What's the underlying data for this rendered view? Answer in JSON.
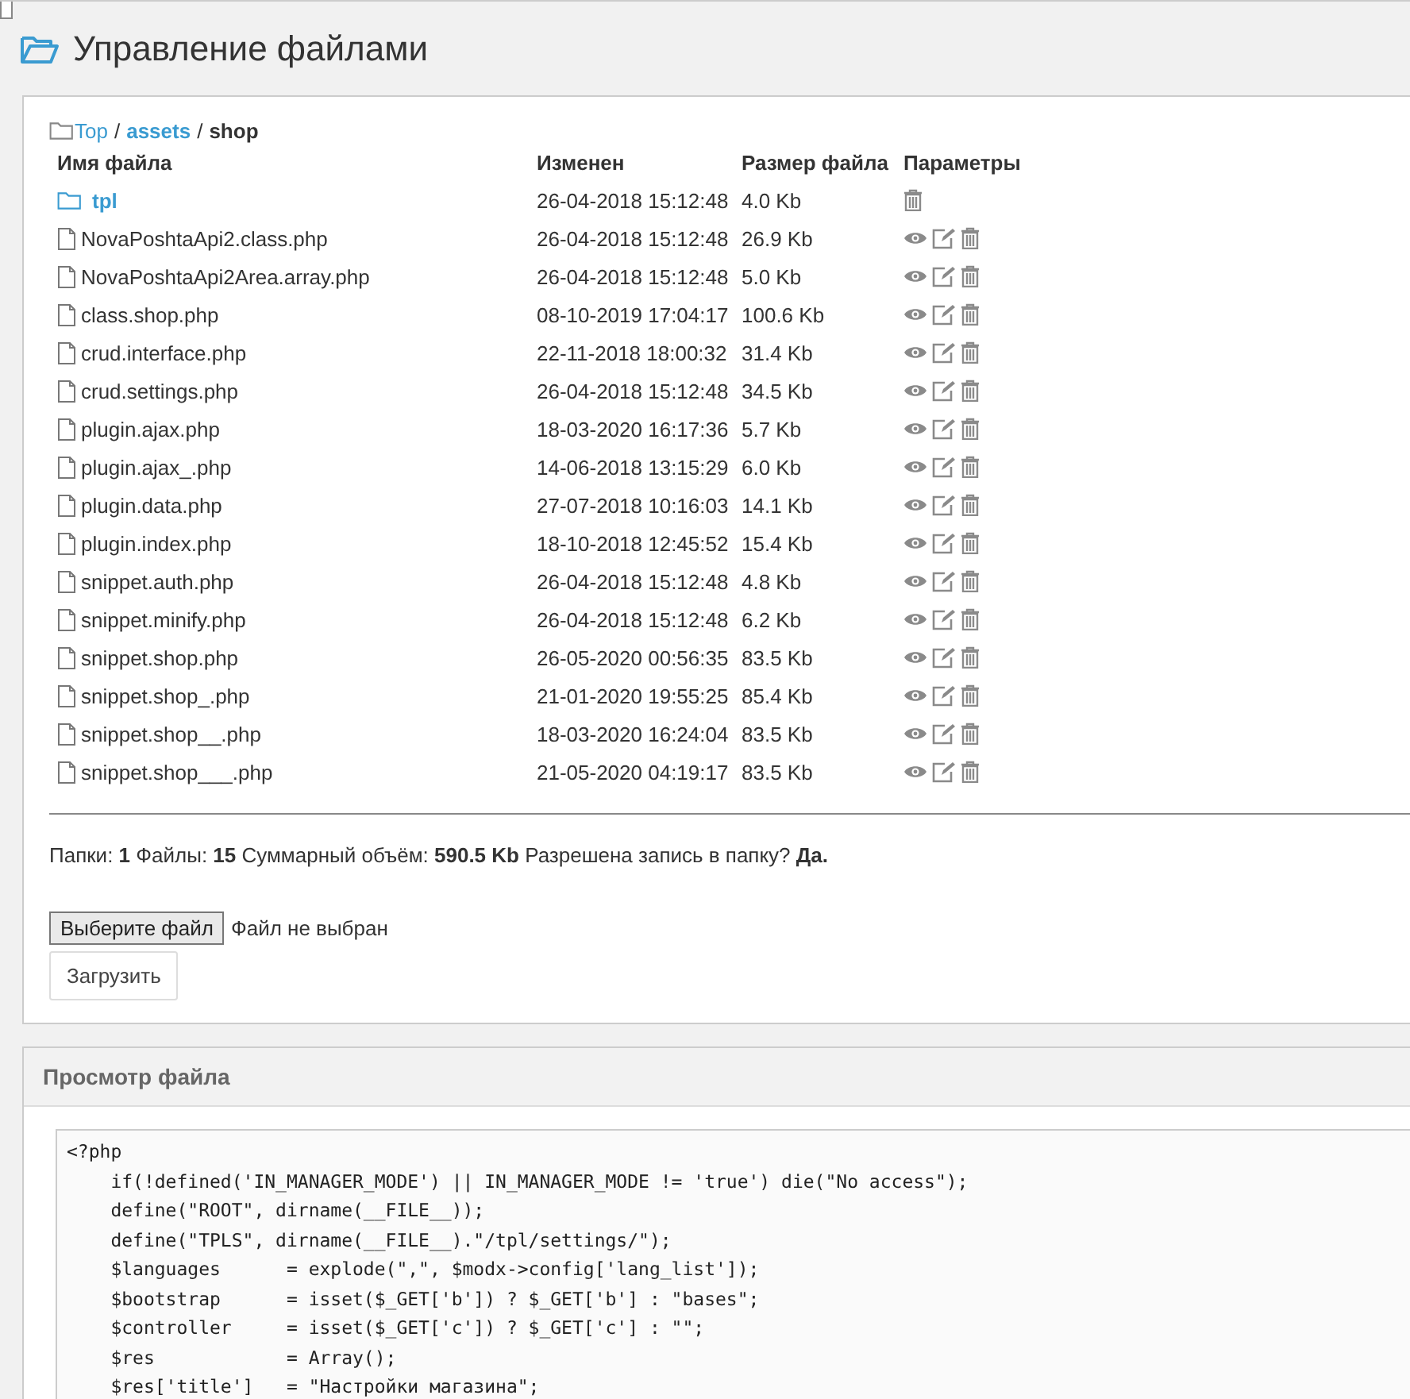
{
  "page_title": "Управление файлами",
  "corner_checkbox": {
    "checked": false
  },
  "breadcrumb_separator": "/",
  "breadcrumb": [
    {
      "label": "Top",
      "kind": "link"
    },
    {
      "label": "assets",
      "kind": "link"
    },
    {
      "label": "shop",
      "kind": "current"
    }
  ],
  "table": {
    "columns": [
      "Имя файла",
      "Изменен",
      "Размер файла",
      "Параметры"
    ],
    "rows": [
      {
        "kind": "folder",
        "name": "tpl",
        "modified": "26-04-2018 15:12:48",
        "size": "4.0 Kb"
      },
      {
        "kind": "file",
        "name": "NovaPoshtaApi2.class.php",
        "modified": "26-04-2018 15:12:48",
        "size": "26.9 Kb"
      },
      {
        "kind": "file",
        "name": "NovaPoshtaApi2Area.array.php",
        "modified": "26-04-2018 15:12:48",
        "size": "5.0 Kb"
      },
      {
        "kind": "file",
        "name": "class.shop.php",
        "modified": "08-10-2019 17:04:17",
        "size": "100.6 Kb"
      },
      {
        "kind": "file",
        "name": "crud.interface.php",
        "modified": "22-11-2018 18:00:32",
        "size": "31.4 Kb"
      },
      {
        "kind": "file",
        "name": "crud.settings.php",
        "modified": "26-04-2018 15:12:48",
        "size": "34.5 Kb"
      },
      {
        "kind": "file",
        "name": "plugin.ajax.php",
        "modified": "18-03-2020 16:17:36",
        "size": "5.7 Kb"
      },
      {
        "kind": "file",
        "name": "plugin.ajax_.php",
        "modified": "14-06-2018 13:15:29",
        "size": "6.0 Kb"
      },
      {
        "kind": "file",
        "name": "plugin.data.php",
        "modified": "27-07-2018 10:16:03",
        "size": "14.1 Kb"
      },
      {
        "kind": "file",
        "name": "plugin.index.php",
        "modified": "18-10-2018 12:45:52",
        "size": "15.4 Kb"
      },
      {
        "kind": "file",
        "name": "snippet.auth.php",
        "modified": "26-04-2018 15:12:48",
        "size": "4.8 Kb"
      },
      {
        "kind": "file",
        "name": "snippet.minify.php",
        "modified": "26-04-2018 15:12:48",
        "size": "6.2 Kb"
      },
      {
        "kind": "file",
        "name": "snippet.shop.php",
        "modified": "26-05-2020 00:56:35",
        "size": "83.5 Kb"
      },
      {
        "kind": "file",
        "name": "snippet.shop_.php",
        "modified": "21-01-2020 19:55:25",
        "size": "85.4 Kb"
      },
      {
        "kind": "file",
        "name": "snippet.shop__.php",
        "modified": "18-03-2020 16:24:04",
        "size": "83.5 Kb"
      },
      {
        "kind": "file",
        "name": "snippet.shop___.php",
        "modified": "21-05-2020 04:19:17",
        "size": "83.5 Kb"
      }
    ]
  },
  "summary": "Папки: **1** Файлы: **15** Суммарный объём: **590.5 Kb** Разрешена запись в папку? **Да.**",
  "upload": {
    "choose_button": "Выберите файл",
    "file_status": "Файл не выбран",
    "upload_button": "Загрузить"
  },
  "viewer": {
    "title": "Просмотр файла",
    "code_lines": [
      "<?php",
      "    if(!defined('IN_MANAGER_MODE') || IN_MANAGER_MODE != 'true') die(\"No access\");",
      "    define(\"ROOT\", dirname(__FILE__));",
      "    define(\"TPLS\", dirname(__FILE__).\"/tpl/settings/\");",
      "    $languages      = explode(\",\", $modx->config['lang_list']);",
      "    $bootstrap      = isset($_GET['b']) ? $_GET['b'] : \"bases\";",
      "    $controller     = isset($_GET['c']) ? $_GET['c'] : \"\";",
      "    $res            = Array();",
      "    $res['title']   = \"Настройки магазина\";"
    ]
  }
}
